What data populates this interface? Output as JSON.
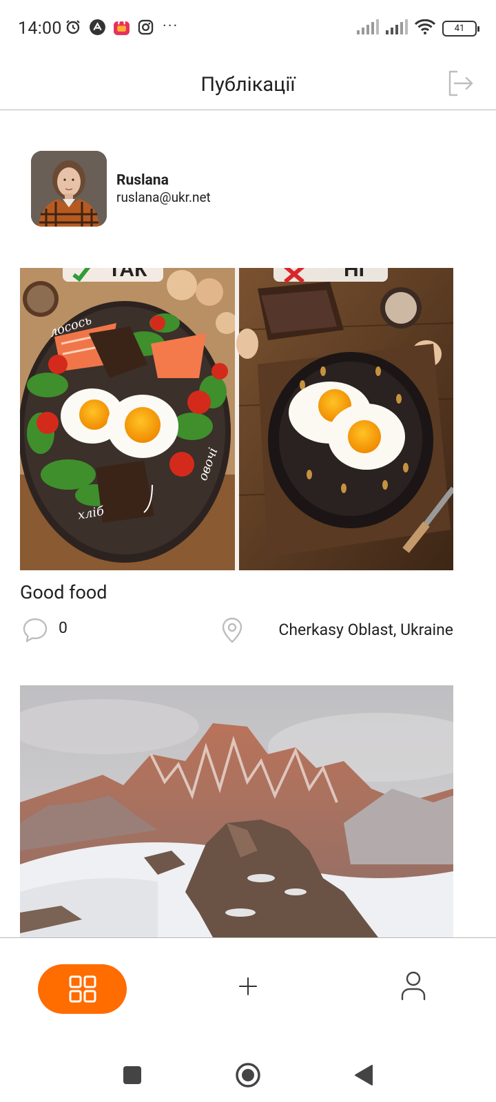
{
  "status_bar": {
    "time": "14:00",
    "battery": "41",
    "more": "···",
    "left_icons": [
      "alarm-icon",
      "app-icon",
      "shopping-bag-icon",
      "instagram-icon"
    ],
    "right_icons": [
      "signal-icon",
      "signal-icon",
      "wifi-icon",
      "battery-icon"
    ]
  },
  "header": {
    "title": "Публікації",
    "logout_icon": "logout-icon"
  },
  "profile": {
    "name": "Ruslana",
    "email": "ruslana@ukr.net"
  },
  "posts": [
    {
      "title": "Good food",
      "comments_count": "0",
      "location": "Cherkasy Oblast, Ukraine",
      "image_labels": {
        "yes": "ТАК",
        "no": "НІ",
        "salmon": "лосось",
        "bread": "хліб",
        "vegetables": "овочі"
      }
    },
    {
      "title": "",
      "comments_count": "",
      "location": ""
    }
  ],
  "tab_bar": {
    "active": "posts",
    "items": [
      "grid-icon",
      "plus-icon",
      "user-icon"
    ]
  },
  "colors": {
    "accent": "#FF6C00",
    "text": "#212121",
    "icon_gray": "#BDBDBD",
    "border": "#B7B7B7"
  }
}
